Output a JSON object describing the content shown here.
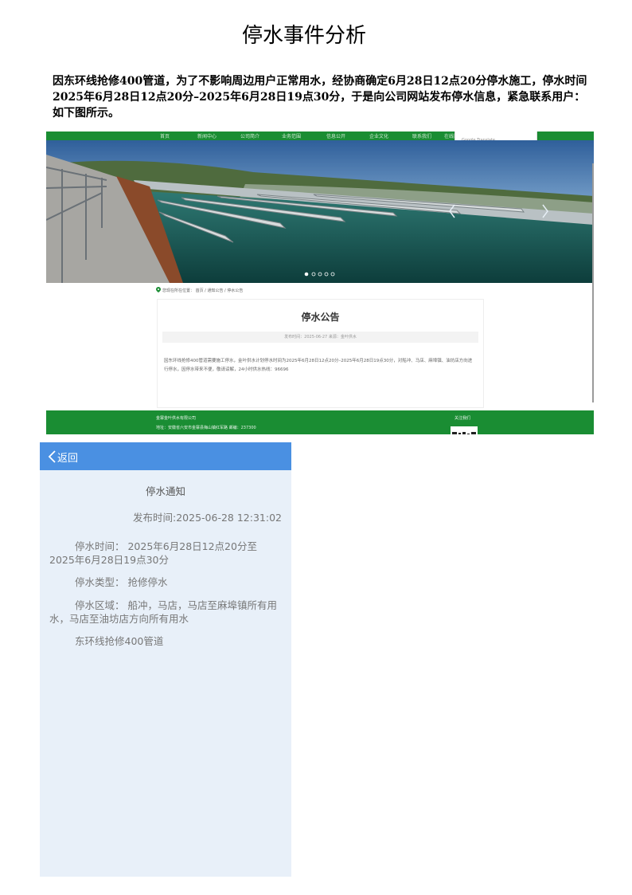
{
  "document": {
    "title": "停水事件分析",
    "intro": "因东环线抢修400管道，为了不影响周边用户正常用水，经协商确定6月28日12点20分停水施工，停水时间2025年6月28日12点20分–2025年6月28日19点30分，于是向公司网站发布停水信息，紧急联系用户：如下图所示。"
  },
  "website": {
    "nav_items": [
      "首页",
      "新闻中心",
      "公司简介",
      "业务范围",
      "信息公开",
      "企业文化",
      "联系我们",
      "在线服务"
    ],
    "translate_popup": "Google Translate",
    "banner_dots": 5,
    "breadcrumb": "您现在所在位置：  首页 / 通知公告 / 停水公告",
    "notice_title": "停水公告",
    "notice_meta": "发布时间：2025-06-27     来源：金叶供水",
    "notice_body": "因东环线抢修400管道需要施工停水，金叶供水计划停水时间为2025年6月28日12点20分–2025年6月28日19点30分，对船冲、马店、麻埠镇、油坊店方向进行停水，因停水带来不便，敬请谅解，24小时供水热线：96696",
    "footer_company": "金寨金叶供水有限公司",
    "footer_address": "地址：安徽省六安市金寨县梅山镇红军路    邮编：237300",
    "footer_follow": "关注我们"
  },
  "mobile": {
    "back_label": "返回",
    "title": "停水通知",
    "publish_time": "发布时间:2025-06-28 12:31:02",
    "paragraphs": [
      "停水时间：  2025年6月28日12点20分至2025年6月28日19点30分",
      "停水类型：  抢修停水",
      "停水区域：  船冲，马店，马店至麻埠镇所有用水，马店至油坊店方向所有用水",
      "东环线抢修400管道"
    ]
  },
  "colors": {
    "site_green": "#1a8d33",
    "mobile_header_blue": "#4a90e2",
    "mobile_bg": "#e8f0f9"
  },
  "icons": [
    "location-pin-icon",
    "back-chevron-icon",
    "carousel-prev-icon",
    "carousel-next-icon"
  ]
}
